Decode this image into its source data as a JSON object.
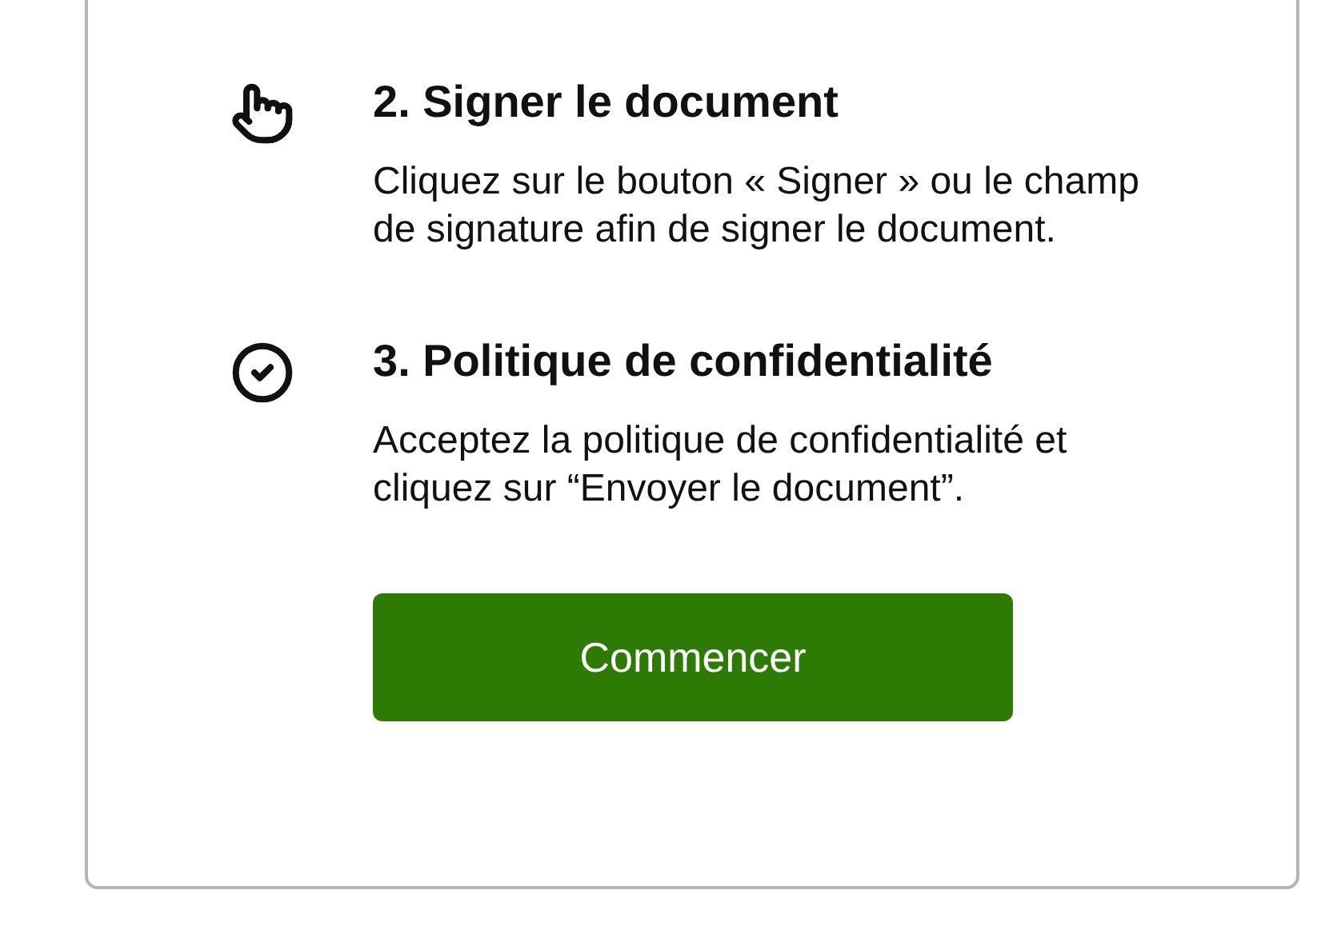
{
  "steps": [
    {
      "kind": "pointer",
      "title": "2. Signer le document",
      "text": "Cliquez sur le bouton « Signer » ou le champ de signature afin de signer le document."
    },
    {
      "kind": "check",
      "title": "3. Politique de confidentialité",
      "text": "Acceptez la politique de confidentialité et cliquez sur “Envoyer le document”."
    }
  ],
  "button": {
    "label": "Commencer"
  }
}
